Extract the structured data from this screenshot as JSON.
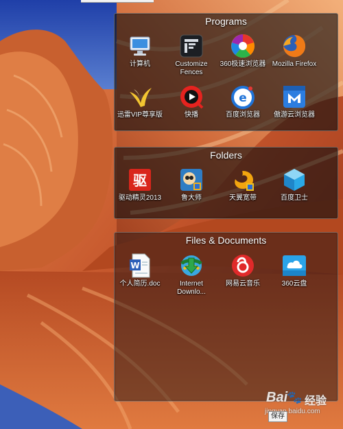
{
  "fences": {
    "programs": {
      "title": "Programs",
      "items": [
        {
          "label": "计算机",
          "icon": "computer-icon"
        },
        {
          "label": "Customize Fences",
          "icon": "fences-icon"
        },
        {
          "label": "360极速浏览器",
          "icon": "360-chrome-icon"
        },
        {
          "label": "Mozilla Firefox",
          "icon": "firefox-icon"
        },
        {
          "label": "迅雷VIP尊享版",
          "icon": "thunder-icon"
        },
        {
          "label": "快播",
          "icon": "qvod-icon"
        },
        {
          "label": "百度浏览器",
          "icon": "baidu-browser-icon"
        },
        {
          "label": "傲游云浏览器",
          "icon": "maxthon-icon"
        }
      ]
    },
    "folders": {
      "title": "Folders",
      "items": [
        {
          "label": "驱动精灵2013",
          "icon": "driver-genius-icon"
        },
        {
          "label": "鲁大师",
          "icon": "ludashi-icon"
        },
        {
          "label": "天翼宽带",
          "icon": "tianyi-icon"
        },
        {
          "label": "百度卫士",
          "icon": "baidu-guard-icon"
        }
      ]
    },
    "documents": {
      "title": "Files & Documents",
      "items": [
        {
          "label": "个人简历.doc",
          "icon": "word-doc-icon"
        },
        {
          "label": "Internet Downlo...",
          "icon": "idm-icon"
        },
        {
          "label": "网易云音乐",
          "icon": "netease-music-icon"
        },
        {
          "label": "360云盘",
          "icon": "360-cloud-icon"
        }
      ]
    }
  },
  "save_badge": "保存",
  "watermark": {
    "brand": "Bai",
    "suffix": "经验",
    "url": "jingyan.baidu.com"
  }
}
